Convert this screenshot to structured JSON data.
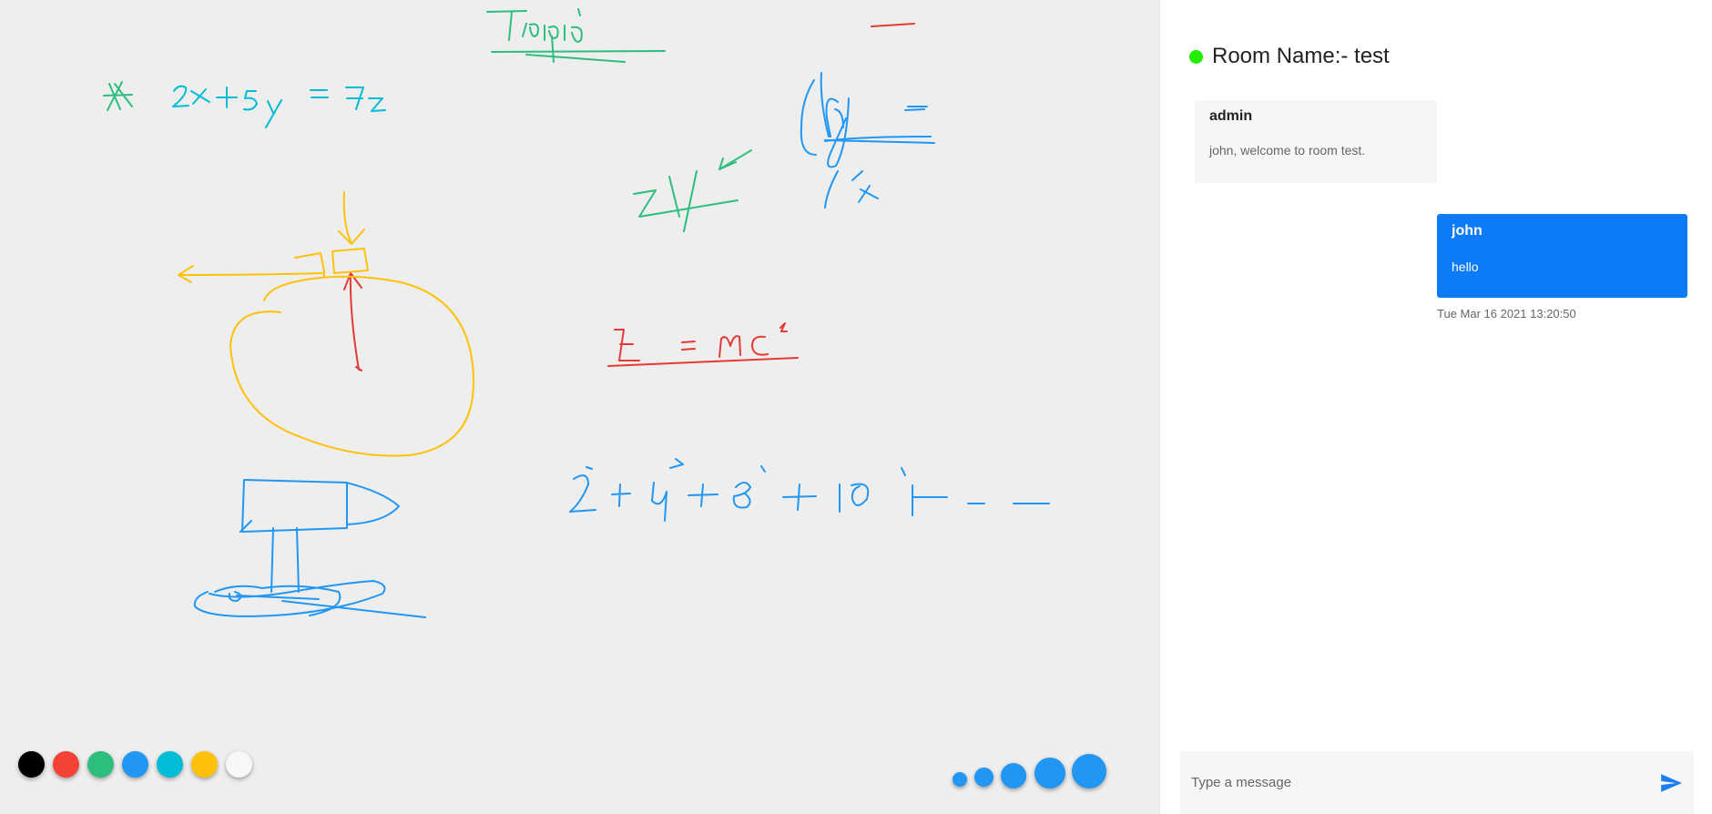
{
  "chat": {
    "room_label": "Room Name:- test",
    "status_color": "#22ee00",
    "messages": [
      {
        "sender": "admin",
        "text": "john, welcome to room test."
      },
      {
        "sender": "john",
        "text": "hello",
        "time": "Tue Mar 16 2021 13:20:50"
      }
    ],
    "composer": {
      "placeholder": "Type a message",
      "value": "",
      "send_icon": "send-icon"
    }
  },
  "board": {
    "background": "#eeeeee",
    "colors": [
      {
        "name": "black",
        "hex": "#000000"
      },
      {
        "name": "red",
        "hex": "#f44336"
      },
      {
        "name": "green",
        "hex": "#2dbe7e"
      },
      {
        "name": "blue",
        "hex": "#2196f3"
      },
      {
        "name": "cyan",
        "hex": "#00bcd4"
      },
      {
        "name": "yellow",
        "hex": "#ffc107"
      },
      {
        "name": "white",
        "hex": "#f7f7f7"
      }
    ],
    "brush_sizes": [
      "xs",
      "s",
      "m",
      "l",
      "xl"
    ]
  }
}
